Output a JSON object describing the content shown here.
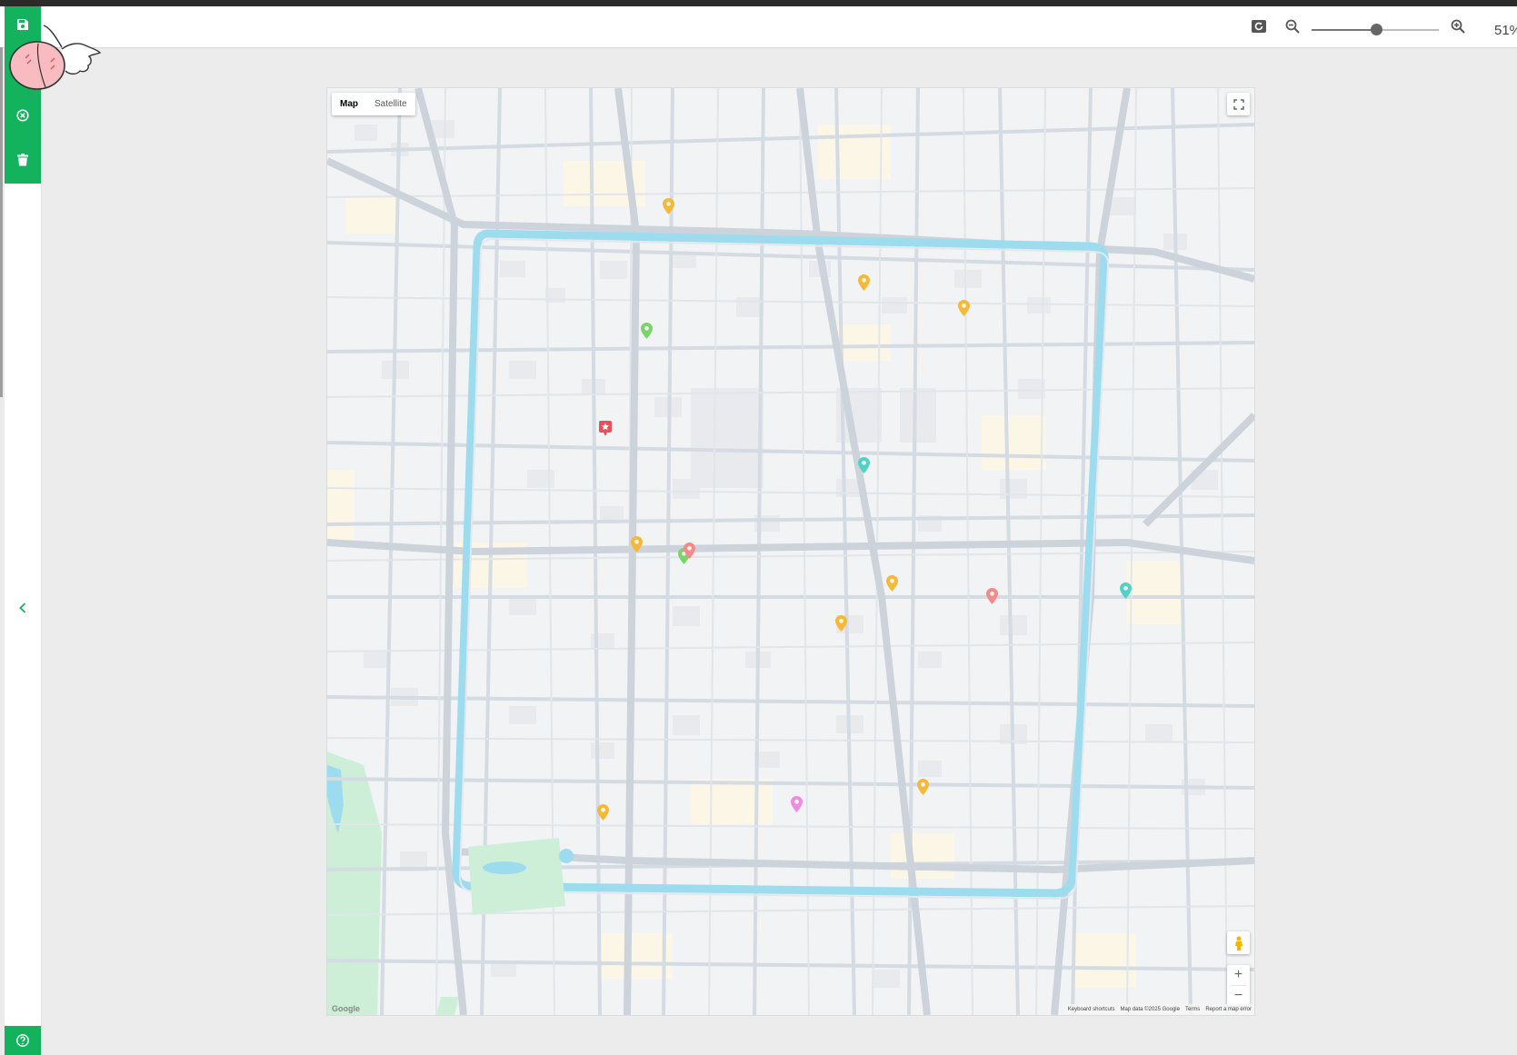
{
  "toolbar": {
    "zoom_percent": "51%",
    "zoom_level": 0.51,
    "icons": [
      "rotate-icon",
      "zoom-out-icon",
      "zoom-in-icon"
    ]
  },
  "sidebar": {
    "icons": [
      "save-icon",
      "close-circle-icon",
      "trash-icon",
      "chevron-left-icon",
      "help-icon"
    ],
    "accent_color": "#13b25c"
  },
  "map": {
    "type_buttons": [
      "Map",
      "Satellite"
    ],
    "active_type": "Map",
    "logo": "Google",
    "attribution": {
      "shortcuts": "Keyboard shortcuts",
      "data": "Map data ©2025 Google",
      "terms": "Terms",
      "report": "Report a map error"
    },
    "zoom_in_label": "+",
    "zoom_out_label": "−",
    "colors": {
      "background": "#f1f3f4",
      "road": "#d4dbe3",
      "moat": "#9ddcef",
      "park": "#cdeed7"
    },
    "markers": [
      {
        "color": "#f5b93a",
        "icon": "map-pin-icon"
      },
      {
        "color": "#f5b93a",
        "icon": "map-pin-icon"
      },
      {
        "color": "#f5b93a",
        "icon": "map-pin-icon"
      },
      {
        "color": "#7bd36b",
        "icon": "map-pin-icon"
      },
      {
        "color": "#e8515b",
        "icon": "starred-place-icon"
      },
      {
        "color": "#52d2c2",
        "icon": "map-pin-icon"
      },
      {
        "color": "#f5b93a",
        "icon": "map-pin-icon"
      },
      {
        "color": "#7bd36b",
        "icon": "map-pin-icon"
      },
      {
        "color": "#f48a8a",
        "icon": "map-pin-icon"
      },
      {
        "color": "#f5b93a",
        "icon": "map-pin-icon"
      },
      {
        "color": "#f48a8a",
        "icon": "map-pin-icon"
      },
      {
        "color": "#52d2c2",
        "icon": "map-pin-icon"
      },
      {
        "color": "#f5b93a",
        "icon": "map-pin-icon"
      },
      {
        "color": "#f5b93a",
        "icon": "map-pin-icon"
      },
      {
        "color": "#f5b93a",
        "icon": "map-pin-icon"
      },
      {
        "color": "#ec8ee0",
        "icon": "map-pin-icon"
      }
    ]
  }
}
